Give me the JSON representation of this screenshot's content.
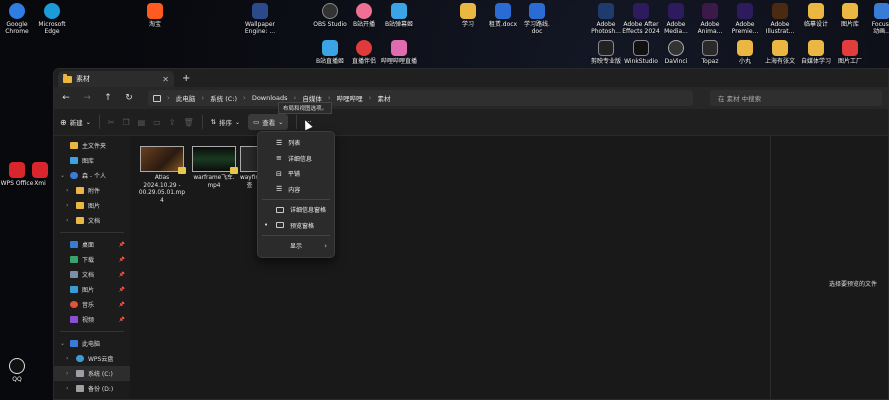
{
  "desktop": {
    "icons": [
      {
        "label": "Google\nChrome",
        "color": "#2f7de1"
      },
      {
        "label": "Microsoft\nEdge",
        "color": "#1b9bd8"
      },
      {
        "label": "淘宝",
        "color": "#ff5a1f"
      },
      {
        "label": "Wallpaper\nEngine: ...",
        "color": "#2c4a8a"
      },
      {
        "label": "OBS Studio",
        "color": "#333333"
      },
      {
        "label": "B站开播",
        "color": "#ef6f95"
      },
      {
        "label": "B站弹幕姬",
        "color": "#3aa4e6"
      },
      {
        "label": "学习",
        "color": "#e9b742"
      },
      {
        "label": "租赁.docx",
        "color": "#2b6cd4"
      },
      {
        "label": "学习路线.\ndoc",
        "color": "#2b6cd4"
      },
      {
        "label": "Adobe\nPhotosh...",
        "color": "#1f3b6e"
      },
      {
        "label": "Adobe After\nEffects 2024",
        "color": "#2d1b5e"
      },
      {
        "label": "Adobe\nMedia...",
        "color": "#2d1b5e"
      },
      {
        "label": "Adobe\nAnima...",
        "color": "#3b1a4a"
      },
      {
        "label": "Adobe\nPremie...",
        "color": "#2d1b5e"
      },
      {
        "label": "Adobe\nIllustrat...",
        "color": "#4a2a10"
      },
      {
        "label": "临摹设计",
        "color": "#e9b742"
      },
      {
        "label": "图片库",
        "color": "#e9b742"
      },
      {
        "label": "Focusk\n动画...",
        "color": "#3a7bd5"
      },
      {
        "label": "B站直播姬",
        "color": "#3aa4e6"
      },
      {
        "label": "直播伴侣",
        "color": "#e03a3a"
      },
      {
        "label": "哔哩哔哩直播",
        "color": "#e06bb0"
      },
      {
        "label": "剪映专业版",
        "color": "#222222"
      },
      {
        "label": "WinkStudio",
        "color": "#111111"
      },
      {
        "label": "DaVinci",
        "color": "#333333"
      },
      {
        "label": "Topaz",
        "color": "#2a2a2a"
      },
      {
        "label": "小丸",
        "color": "#e9b742"
      },
      {
        "label": "上海有张文",
        "color": "#e9b742"
      },
      {
        "label": "自媒体学习",
        "color": "#e9b742"
      },
      {
        "label": "图片工厂",
        "color": "#e23d3d"
      },
      {
        "label": "WPS Office",
        "color": "#d9262c"
      },
      {
        "label": "Xmi",
        "color": "#d9262c"
      },
      {
        "label": "QQ",
        "color": "#111111"
      }
    ]
  },
  "window": {
    "tab_title": "素材",
    "close_label": "✕",
    "new_tab_label": "+",
    "nav": {
      "back": "←",
      "forward": "→",
      "up": "↑",
      "refresh": "↻"
    },
    "breadcrumbs": [
      "此电脑",
      "系统 (C:)",
      "Downloads",
      "自媒体",
      "哔哩哔哩",
      "素材"
    ],
    "crumb_sep": "›",
    "search_placeholder": "在 素材 中搜索"
  },
  "toolbar": {
    "new_label": "新建",
    "sort_label": "排序",
    "view_label": "查看",
    "more_label": "···",
    "tooltip": "布局和视图选项。"
  },
  "sidebar": {
    "items": [
      {
        "label": "主文件夹",
        "color": "#e9b742",
        "arrow": ""
      },
      {
        "label": "图库",
        "color": "#3aa4e6",
        "arrow": ""
      },
      {
        "label": "森 - 个人",
        "color": "#3a7bd5",
        "arrow": "⌄"
      },
      {
        "label": "附件",
        "color": "#e9b742",
        "arrow": "›"
      },
      {
        "label": "图片",
        "color": "#e9b742",
        "arrow": "›"
      },
      {
        "label": "文档",
        "color": "#e9b742",
        "arrow": "›"
      },
      {
        "label": "桌面",
        "color": "#3a7bd5",
        "arrow": "",
        "pin": "📌"
      },
      {
        "label": "下载",
        "color": "#3aa36a",
        "arrow": "",
        "pin": "📌"
      },
      {
        "label": "文档",
        "color": "#7a8fa8",
        "arrow": "",
        "pin": "📌"
      },
      {
        "label": "图片",
        "color": "#3a9bd5",
        "arrow": "",
        "pin": "📌"
      },
      {
        "label": "音乐",
        "color": "#e0553a",
        "arrow": "",
        "pin": "📌"
      },
      {
        "label": "视频",
        "color": "#8a4fd5",
        "arrow": "",
        "pin": "📌"
      },
      {
        "label": "此电脑",
        "color": "#3a7bd5",
        "arrow": "⌄"
      },
      {
        "label": "WPS云盘",
        "color": "#3a9bd5",
        "arrow": "›"
      },
      {
        "label": "系统 (C:)",
        "color": "#9aa0a6",
        "arrow": "›"
      },
      {
        "label": "备份 (D:)",
        "color": "#9aa0a6",
        "arrow": "›"
      }
    ]
  },
  "files": [
    {
      "name": "Atlas\n2024.10.29 -\n00.29.05.01.mp\n4",
      "thumb": "#4a3220"
    },
    {
      "name": "warframe飞车.\nmp4",
      "thumb": "#16301c"
    },
    {
      "name": "wayfin\n查",
      "thumb": "#2a2a2a"
    }
  ],
  "view_menu": {
    "items": [
      {
        "label": "列表",
        "bullet": ""
      },
      {
        "label": "详细信息",
        "bullet": ""
      },
      {
        "label": "平铺",
        "bullet": ""
      },
      {
        "label": "内容",
        "bullet": ""
      },
      {
        "label": "详细信息窗格",
        "bullet": ""
      },
      {
        "label": "预览窗格",
        "bullet": "•"
      },
      {
        "label": "显示",
        "bullet": "",
        "submenu": "›"
      }
    ]
  },
  "preview": {
    "message": "选择要预览的文件"
  }
}
